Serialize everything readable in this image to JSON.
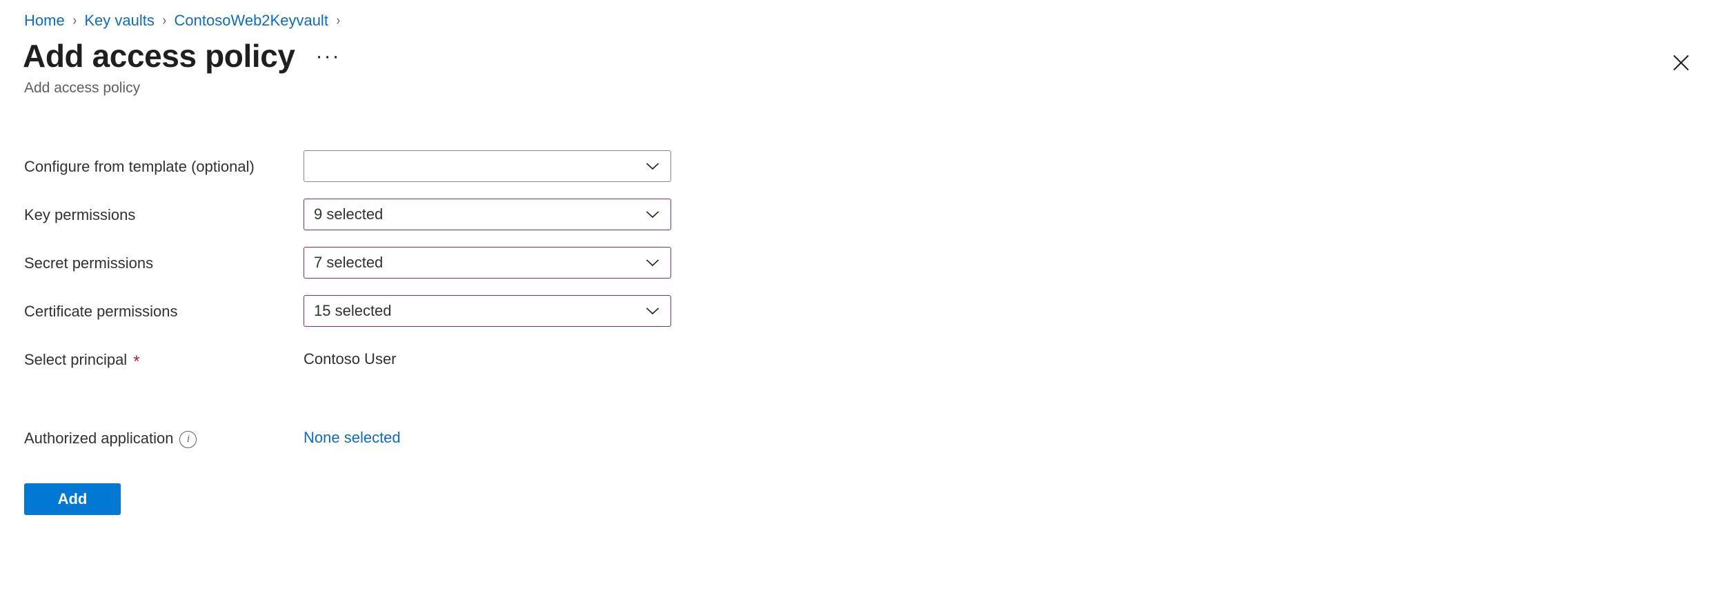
{
  "breadcrumb": {
    "items": [
      {
        "label": "Home"
      },
      {
        "label": "Key vaults"
      },
      {
        "label": "ContosoWeb2Keyvault"
      }
    ],
    "separator": "›"
  },
  "header": {
    "title": "Add access policy",
    "subtitle": "Add access policy",
    "more_label": "···",
    "close_icon": "close-icon"
  },
  "form": {
    "fields": [
      {
        "label": "Configure from template (optional)",
        "control": "dropdown",
        "value": "",
        "modified": false
      },
      {
        "label": "Key permissions",
        "control": "dropdown",
        "value": "9 selected",
        "modified": true
      },
      {
        "label": "Secret permissions",
        "control": "dropdown",
        "value": "7 selected",
        "modified": true
      },
      {
        "label": "Certificate permissions",
        "control": "dropdown",
        "value": "15 selected",
        "modified": true
      }
    ],
    "select_principal": {
      "label": "Select principal",
      "required_marker": "*",
      "value": "Contoso User"
    },
    "authorized_application": {
      "label": "Authorized application",
      "info_icon": "info-icon",
      "info_glyph": "i",
      "value": "None selected"
    }
  },
  "actions": {
    "add_label": "Add"
  },
  "colors": {
    "link": "#0f6cbd",
    "primary": "#0078d4",
    "modified_border": "#7b2d8b",
    "default_border": "#8a8886",
    "required": "#a4262c",
    "subtitle": "#605e5c"
  }
}
